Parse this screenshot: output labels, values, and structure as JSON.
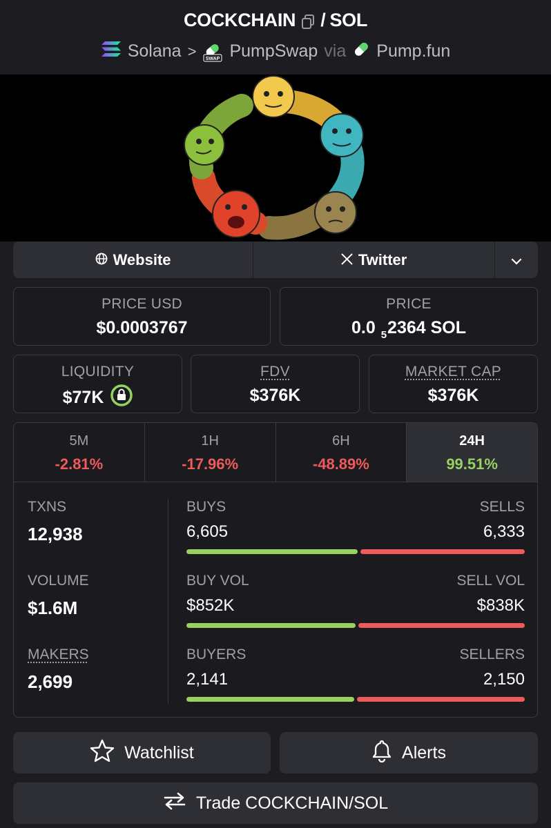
{
  "header": {
    "token": "COCKCHAIN",
    "separator": "/",
    "quote": "SOL",
    "chain": "Solana",
    "chevron": ">",
    "dex": "PumpSwap",
    "dex_badge": "SWAP",
    "via": "via",
    "launchpad": "Pump.fun"
  },
  "links": {
    "website": "Website",
    "twitter": "Twitter"
  },
  "price": {
    "usd_label": "PRICE USD",
    "usd_value": "$0.0003767",
    "native_label": "PRICE",
    "native_prefix": "0.0",
    "native_zeros": "5",
    "native_rest": "2364 SOL"
  },
  "metrics": {
    "liquidity_label": "LIQUIDITY",
    "liquidity_value": "$77K",
    "fdv_label": "FDV",
    "fdv_value": "$376K",
    "mcap_label": "MARKET CAP",
    "mcap_value": "$376K"
  },
  "timeframes": [
    {
      "label": "5M",
      "value": "-2.81%"
    },
    {
      "label": "1H",
      "value": "-17.96%"
    },
    {
      "label": "6H",
      "value": "-48.89%"
    },
    {
      "label": "24H",
      "value": "99.51%"
    }
  ],
  "stats": {
    "txns_label": "TXNS",
    "txns_value": "12,938",
    "volume_label": "VOLUME",
    "volume_value": "$1.6M",
    "makers_label": "MAKERS",
    "makers_value": "2,699",
    "buys_label": "BUYS",
    "buys_value": "6,605",
    "sells_label": "SELLS",
    "sells_value": "6,333",
    "buy_vol_label": "BUY VOL",
    "buy_vol_value": "$852K",
    "sell_vol_label": "SELL VOL",
    "sell_vol_value": "$838K",
    "buyers_label": "BUYERS",
    "buyers_value": "2,141",
    "sellers_label": "SELLERS",
    "sellers_value": "2,150"
  },
  "ratios": {
    "txns_buy_fraction": 0.51,
    "volume_buy_fraction": 0.504,
    "makers_buy_fraction": 0.499
  },
  "actions": {
    "watchlist": "Watchlist",
    "alerts": "Alerts",
    "trade": "Trade COCKCHAIN/SOL"
  },
  "colors": {
    "background": "#1c1c21",
    "positive": "#97d160",
    "negative": "#ef5a5a"
  }
}
